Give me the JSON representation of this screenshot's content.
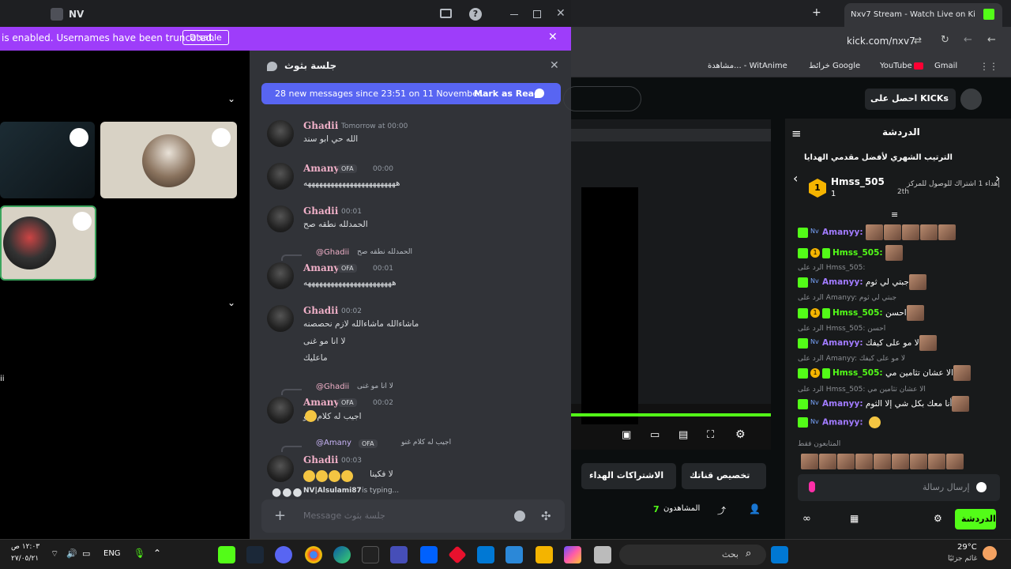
{
  "discord": {
    "window_title": "NV",
    "banner_text": "is enabled. Usernames have been truncated.",
    "banner_button": "Disable",
    "thread_title": "جلسة بثوث",
    "new_messages_text": "28 new messages since 23:51 on 11 November...",
    "mark_as_read": "Mark as Read",
    "typing_user": "NV|Alsulami87",
    "typing_suffix": "is typing...",
    "input_placeholder": "Message جلسة بثوث",
    "messages": [
      {
        "name": "Ghadii",
        "time": "Tomorrow at 00:00",
        "lines": [
          "الله حي ابو سند"
        ]
      },
      {
        "name": "Amany",
        "badge": "OFA",
        "time": "00:00",
        "lines": [
          "ههههههههههههههههههههههههه"
        ]
      },
      {
        "name": "Ghadii",
        "time": "00:01",
        "lines": [
          "الحمدلله نطقه صح"
        ]
      },
      {
        "reply_to": "@Ghadii",
        "reply_text": "الحمدلله نطقه صح",
        "name": "Amany",
        "badge": "OFA",
        "time": "00:01",
        "lines": [
          "هههههههههههههههههههههههه"
        ]
      },
      {
        "name": "Ghadii",
        "time": "00:02",
        "lines": [
          "ماشاءالله ماشاءالله لازم نحصصنه",
          "لا انا مو غنى",
          "ماعليك"
        ]
      },
      {
        "reply_to": "@Ghadii",
        "reply_text": "لا انا مو غنى",
        "name": "Amany",
        "badge": "OFA",
        "time": "00:02",
        "lines": [
          "اجيب له كلام غنو"
        ]
      },
      {
        "reply_to": "@Amany",
        "reply_badge": "OFA",
        "reply_text": "اجيب له كلام غنو",
        "name": "Ghadii",
        "time": "00:03",
        "lines": [
          "لا فكينا"
        ]
      }
    ]
  },
  "browser": {
    "tab_title": "Nxv7 Stream - Watch Live on Ki",
    "url": "kick.com/nxv7",
    "bookmarks": [
      "Gmail",
      "YouTube",
      "خرائط Google",
      "مشاهدة... - WitAnime"
    ],
    "kicks_button": "احصل على KICKs"
  },
  "kick": {
    "chat_title": "الدردشة",
    "leaderboard_title": "الترتيب الشهري لأفضل مقدمي الهدايا",
    "top_user": "Hmss_505",
    "top_count": "1",
    "progress_text": "إهداء 1 اشتراك للوصول للمركز",
    "progress_rank": "2th",
    "subscribers_only": "المتابعون فقط",
    "send_placeholder": "إرسال رسالة",
    "chat_button": "الدردشة",
    "clip_button": "تخصيص قناتك",
    "gift_button": "الاشتراكات الهداء",
    "viewers_label": "المشاهدون",
    "viewers_count": "7",
    "chat_rows": [
      {
        "user": "Amanyy:",
        "color": "p"
      },
      {
        "user": "Hmss_505:",
        "color": "g",
        "rank": "1"
      },
      {
        "reply": "الرد على Hmss_505:",
        "user": "Amanyy:",
        "color": "p",
        "text": "جبتي لي ثوم"
      },
      {
        "reply": "الرد على Amanyy: جبتي لي ثوم",
        "user": "Hmss_505:",
        "color": "g",
        "rank": "1",
        "text": "احسن"
      },
      {
        "reply": "الرد على Hmss_505: احسن",
        "user": "Amanyy:",
        "color": "p",
        "text": "لا مو على كيفك"
      },
      {
        "reply": "الرد على Amanyy: لا مو على كيفك",
        "user": "Hmss_505:",
        "color": "g",
        "rank": "1",
        "text": "الا عشان تثامين مي"
      },
      {
        "reply": "الرد على Hmss_505: الا عشان تثامين مي",
        "user": "Amanyy:",
        "color": "p",
        "text": "أنا معك بكل شي إلا الثوم"
      },
      {
        "user": "Amanyy:",
        "color": "p"
      }
    ]
  },
  "taskbar": {
    "time": "١٢:٠٣ ص",
    "date": "٢٧/٠٥/٢١",
    "lang": "ENG",
    "search": "بحث",
    "weather_temp": "29°C",
    "weather_text": "غائم جزئيًا"
  },
  "colors": {
    "discord_purple": "#9e3dfa",
    "blurple": "#5865f2",
    "kick_green": "#53fc18"
  }
}
